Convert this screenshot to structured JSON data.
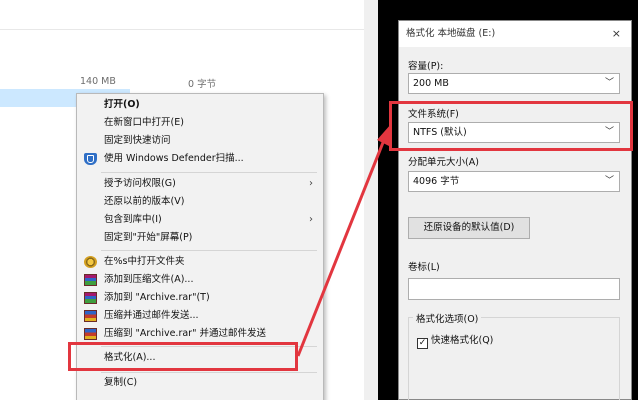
{
  "explorer": {
    "size_a": "140 MB",
    "size_b": "0 字节"
  },
  "context_menu": {
    "items": [
      {
        "label": "打开(O)",
        "icon": ""
      },
      {
        "label": "在新窗口中打开(E)",
        "icon": ""
      },
      {
        "label": "固定到快速访问",
        "icon": ""
      },
      {
        "label": "使用 Windows Defender扫描...",
        "icon": "windows-defender-icon"
      },
      {
        "label": "授予访问权限(G)",
        "icon": ""
      },
      {
        "label": "还原以前的版本(V)",
        "icon": ""
      },
      {
        "label": "包含到库中(I)",
        "icon": ""
      },
      {
        "label": "固定到\"开始\"屏幕(P)",
        "icon": ""
      },
      {
        "label": "在%s中打开文件夹",
        "icon": "winrar-icon"
      },
      {
        "label": "添加到压缩文件(A)...",
        "icon": "winrar-icon"
      },
      {
        "label": "添加到 \"Archive.rar\"(T)",
        "icon": "winrar-icon"
      },
      {
        "label": "压缩并通过邮件发送...",
        "icon": "winrar-icon"
      },
      {
        "label": "压缩到 \"Archive.rar\" 并通过邮件发送",
        "icon": "winrar-icon"
      },
      {
        "label": "格式化(A)...",
        "icon": ""
      },
      {
        "label": "复制(C)",
        "icon": ""
      }
    ]
  },
  "format_dialog": {
    "title": "格式化 本地磁盘 (E:)",
    "close": "×",
    "capacity_label": "容量(P):",
    "capacity_value": "200 MB",
    "filesystem_label": "文件系统(F)",
    "filesystem_value": "NTFS (默认)",
    "alloc_label": "分配单元大小(A)",
    "alloc_value": "4096 字节",
    "restore_button": "还原设备的默认值(D)",
    "volume_label": "卷标(L)",
    "volume_value": "",
    "options_label": "格式化选项(O)",
    "quick_format_label": "快速格式化(Q)",
    "quick_format_checked": true
  },
  "colors": {
    "highlight_red": "#e2363f",
    "selection_blue": "#cce8ff"
  }
}
